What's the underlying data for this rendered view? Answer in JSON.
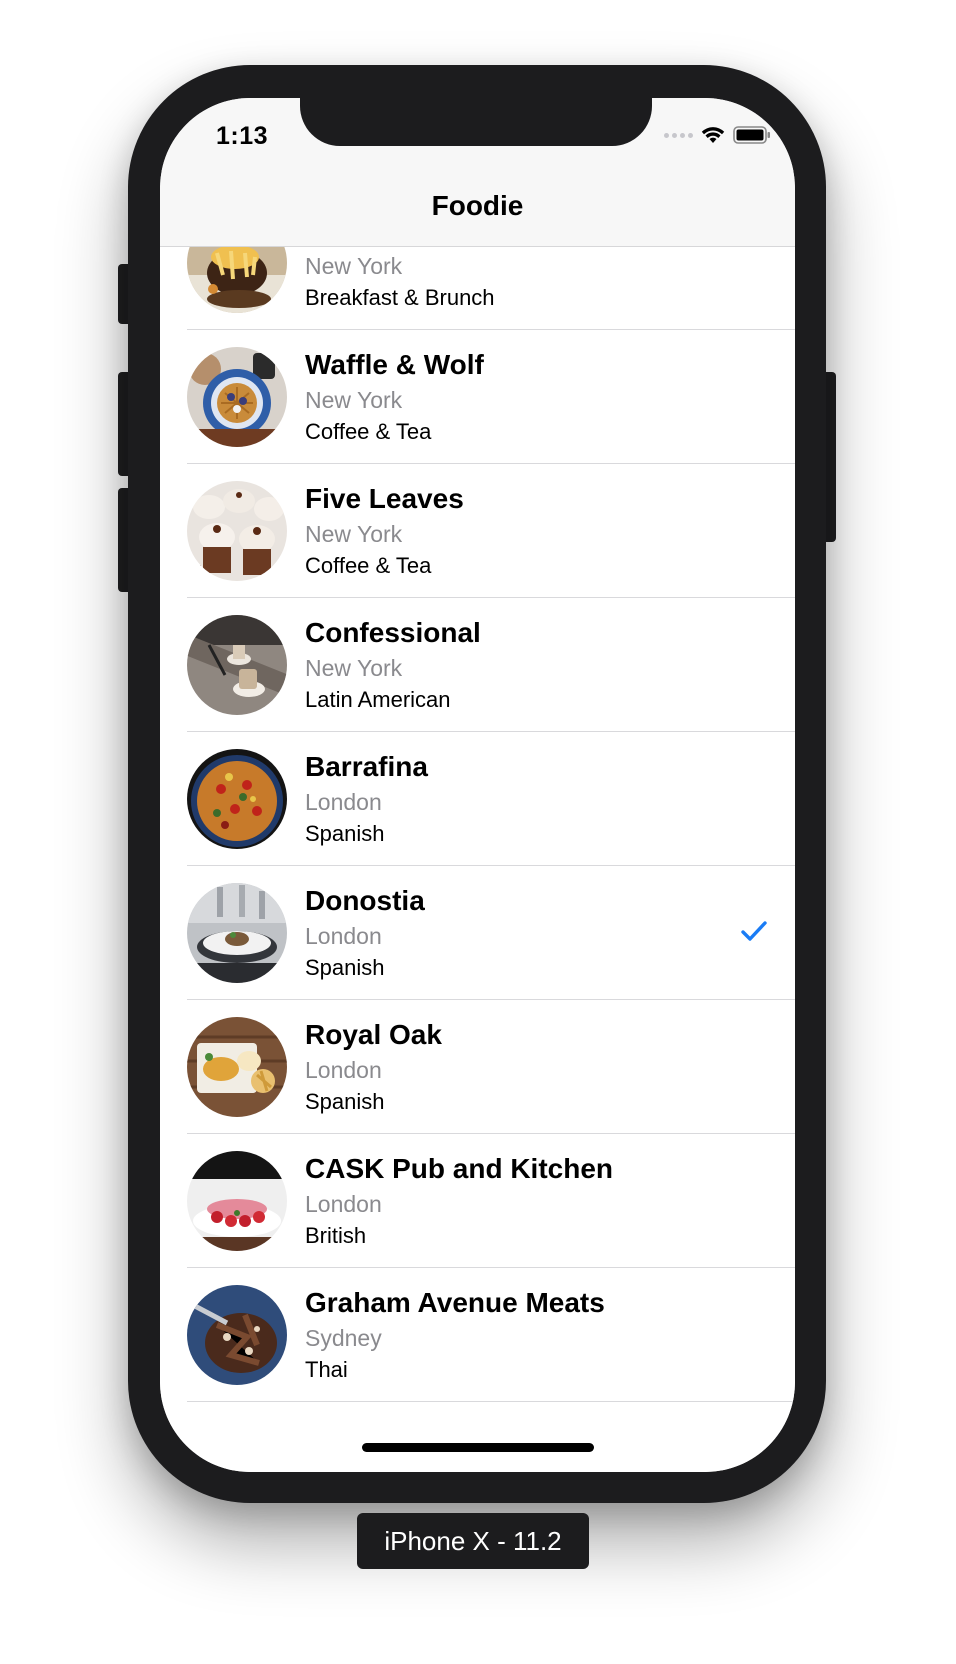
{
  "status_bar": {
    "time": "1:13"
  },
  "nav": {
    "title": "Foodie"
  },
  "restaurants": [
    {
      "name": "",
      "location": "New York",
      "cuisine": "Breakfast & Brunch",
      "selected": false
    },
    {
      "name": "Waffle & Wolf",
      "location": "New York",
      "cuisine": "Coffee & Tea",
      "selected": false
    },
    {
      "name": "Five Leaves",
      "location": "New York",
      "cuisine": "Coffee  & Tea",
      "selected": false
    },
    {
      "name": "Confessional",
      "location": "New York",
      "cuisine": "Latin American",
      "selected": false
    },
    {
      "name": "Barrafina",
      "location": "London",
      "cuisine": "Spanish",
      "selected": false
    },
    {
      "name": "Donostia",
      "location": "London",
      "cuisine": "Spanish",
      "selected": true
    },
    {
      "name": "Royal Oak",
      "location": "London",
      "cuisine": "Spanish",
      "selected": false
    },
    {
      "name": "CASK Pub and Kitchen",
      "location": "London",
      "cuisine": "British",
      "selected": false
    },
    {
      "name": "Graham Avenue Meats",
      "location": "Sydney",
      "cuisine": "Thai",
      "selected": false
    }
  ],
  "simulator_label": "iPhone X - 11.2",
  "colors": {
    "accent": "#1a7cf5",
    "separator": "#d9d9dc",
    "secondary_text": "#8a8a8e",
    "device": "#1c1c1e"
  },
  "icons": {
    "signal": "signal-dots-icon",
    "wifi": "wifi-icon",
    "battery": "battery-icon",
    "checkmark": "checkmark-icon"
  }
}
